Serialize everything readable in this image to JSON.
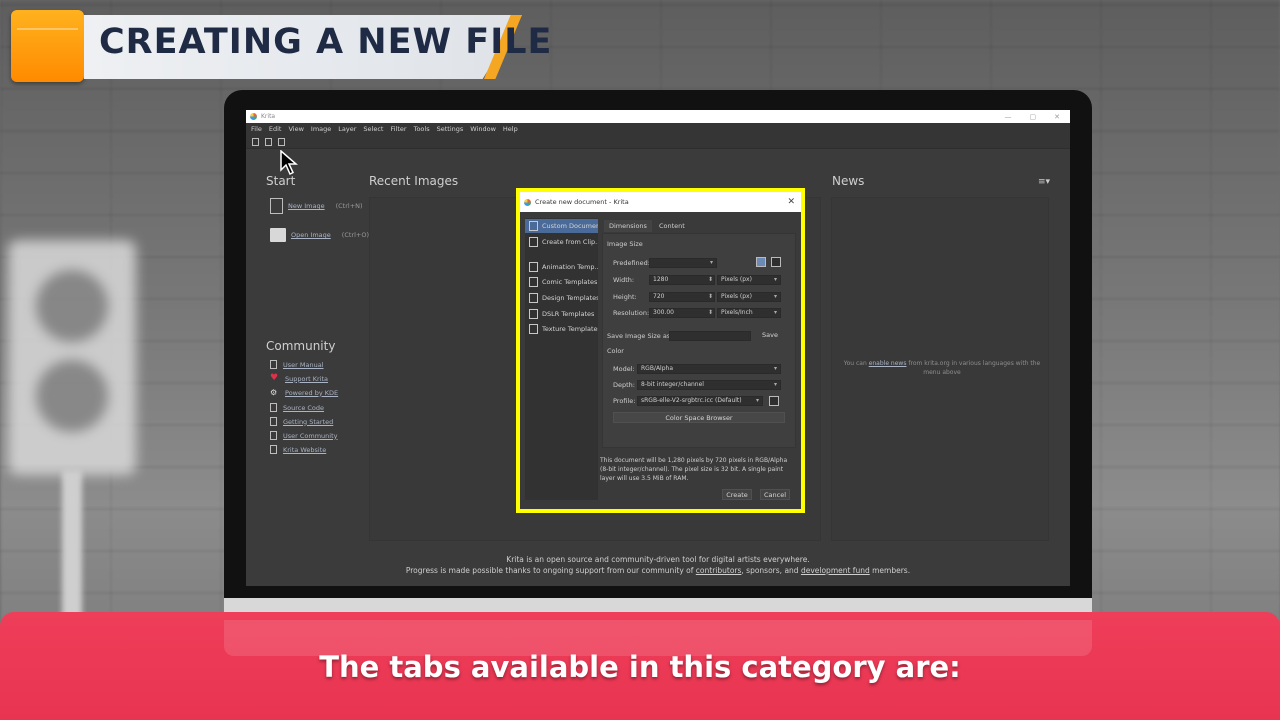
{
  "overlay": {
    "title": "CREATING A NEW FILE",
    "caption": "The tabs available in this category are:"
  },
  "app": {
    "window_title": "Krita",
    "menu": [
      "File",
      "Edit",
      "View",
      "Image",
      "Layer",
      "Select",
      "Filter",
      "Tools",
      "Settings",
      "Window",
      "Help"
    ]
  },
  "welcome": {
    "start_heading": "Start",
    "new_image": "New Image",
    "new_image_shortcut": "(Ctrl+N)",
    "open_image": "Open Image",
    "open_image_shortcut": "(Ctrl+O)",
    "recent_heading": "Recent Images",
    "news_heading": "News",
    "news_text_pre": "You can",
    "news_link": "enable news",
    "news_text_post": "from krita.org in various languages with the menu above",
    "community_heading": "Community",
    "community": [
      "User Manual",
      "Support Krita",
      "Powered by KDE",
      "Source Code",
      "Getting Started",
      "User Community",
      "Krita Website"
    ],
    "footer_line1": "Krita is an open source and community-driven tool for digital artists everywhere.",
    "footer_pre": "Progress is made possible thanks to ongoing support from our community of",
    "footer_link1": "contributors",
    "footer_mid": ", sponsors, and",
    "footer_link2": "development fund",
    "footer_post": "members."
  },
  "dialog": {
    "title": "Create new document - Krita",
    "sidebar": [
      "Custom Document",
      "Create from Clip...",
      "Animation Temp...",
      "Comic Templates",
      "Design Templates",
      "DSLR Templates",
      "Texture Templates"
    ],
    "tabs": [
      "Dimensions",
      "Content"
    ],
    "image_size_heading": "Image Size",
    "predefined_label": "Predefined:",
    "predefined_value": "",
    "width_label": "Width:",
    "width_value": "1280",
    "width_unit": "Pixels (px)",
    "height_label": "Height:",
    "height_value": "720",
    "height_unit": "Pixels (px)",
    "resolution_label": "Resolution:",
    "resolution_value": "300.00",
    "resolution_unit": "Pixels/Inch",
    "save_size_label": "Save Image Size as:",
    "save_button": "Save",
    "color_heading": "Color",
    "model_label": "Model:",
    "model_value": "RGB/Alpha",
    "depth_label": "Depth:",
    "depth_value": "8-bit integer/channel",
    "profile_label": "Profile:",
    "profile_value": "sRGB-elle-V2-srgbtrc.icc (Default)",
    "color_space_button": "Color Space Browser",
    "info": "This document will be 1,280 pixels by 720 pixels in RGB/Alpha (8-bit integer/channel). The pixel size is 32 bit. A single paint layer will use 3.5 MiB of RAM.",
    "create_button": "Create",
    "cancel_button": "Cancel"
  }
}
